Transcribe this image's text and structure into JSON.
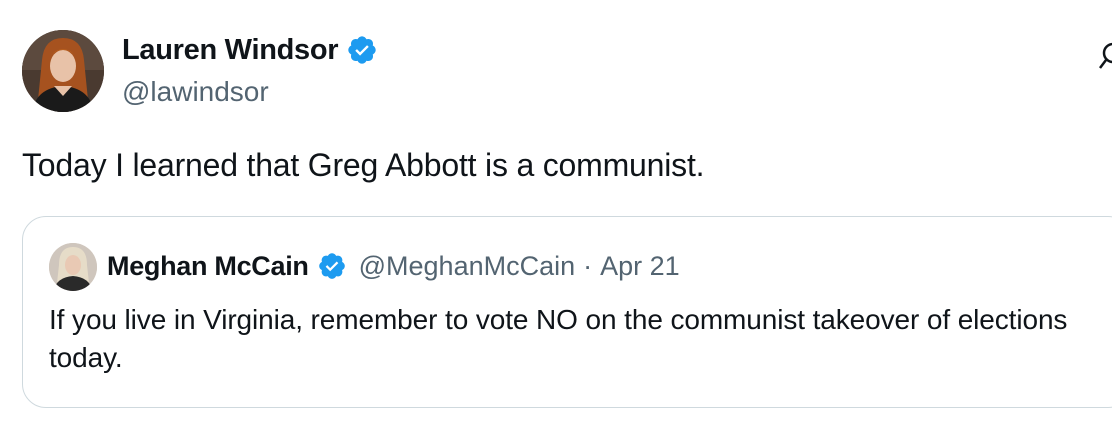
{
  "author": {
    "name": "Lauren Windsor",
    "handle": "@lawindsor",
    "verified": true
  },
  "tweet": {
    "text": "Today I learned that Greg Abbott is a communist."
  },
  "quoted_tweet": {
    "name": "Meghan McCain",
    "handle": "@MeghanMcCain",
    "separator": "·",
    "date": "Apr 21",
    "verified": true,
    "text": "If you live in Virginia, remember to vote NO on the communist takeover of elections today."
  },
  "icons": {
    "verified": "verified-badge-icon",
    "more": "more-icon"
  },
  "colors": {
    "verified_blue": "#1d9bf0",
    "secondary_text": "#536471",
    "border": "#cfd9de",
    "primary_text": "#0f1419"
  }
}
